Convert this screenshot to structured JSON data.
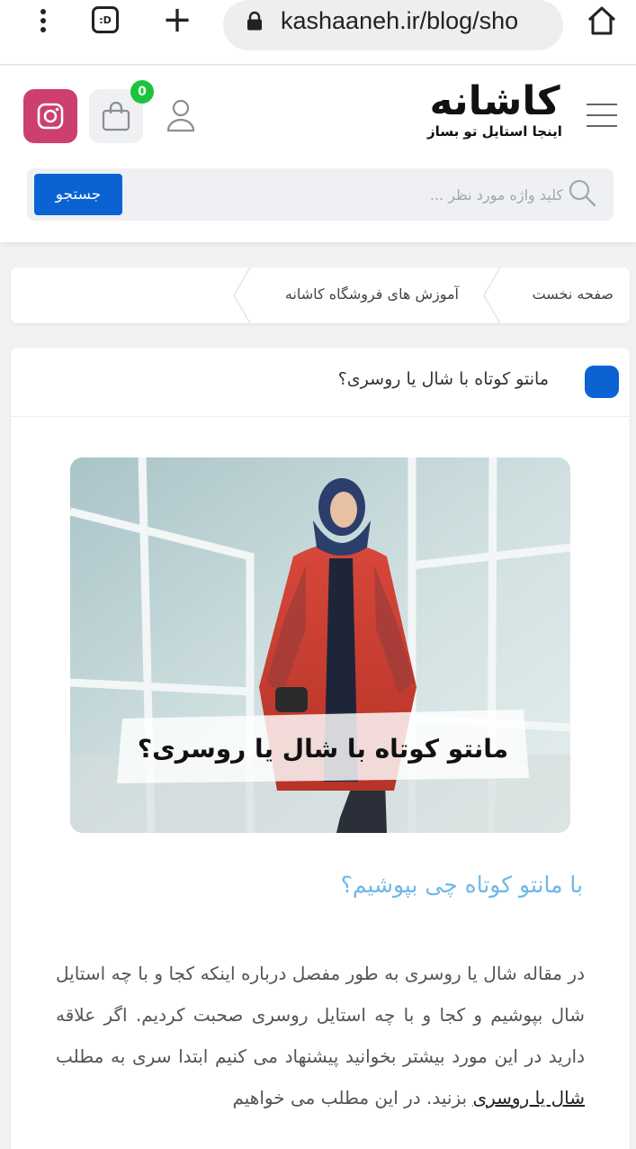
{
  "browser": {
    "url": "kashaaneh.ir/blog/sho",
    "extension_label": ":D"
  },
  "header": {
    "logo_name": "کاشانه",
    "logo_tagline": "اینجا استایل تو بساز",
    "cart_count": "0",
    "search": {
      "placeholder": "کلید واژه مورد نظر ...",
      "button_label": "جستجو"
    }
  },
  "breadcrumb": {
    "items": [
      "صفحه نخست",
      "آموزش های فروشگاه کاشانه"
    ]
  },
  "article": {
    "title": "مانتو کوتاه با شال یا روسری؟",
    "hero_caption": "مانتو کوتاه با شال یا روسری؟",
    "sub_heading": "با مانتو کوتاه چی بپوشیم؟",
    "body_before_link": "در مقاله شال یا روسری به طور مفصل درباره اینکه کجا و با چه استایل شال بپوشیم و کجا و با چه استایل روسری صحبت کردیم. اگر علاقه دارید در این مورد بیشتر بخوانید پیشنهاد می کنیم ابتدا سری به مطلب ",
    "body_link": "شال یا روسری",
    "body_after_link": " بزنید. در این مطلب می خواهیم"
  },
  "colors": {
    "accent_blue": "#0b63d3",
    "instagram_pink": "#cc3f6f",
    "badge_green": "#1bc43c",
    "subheading_blue": "#6fb8e6"
  },
  "icons": [
    "kebab-menu-icon",
    "extension-icon",
    "new-tab-icon",
    "lock-icon",
    "home-icon",
    "instagram-icon",
    "shopping-bag-icon",
    "user-icon",
    "hamburger-menu-icon",
    "search-icon"
  ]
}
